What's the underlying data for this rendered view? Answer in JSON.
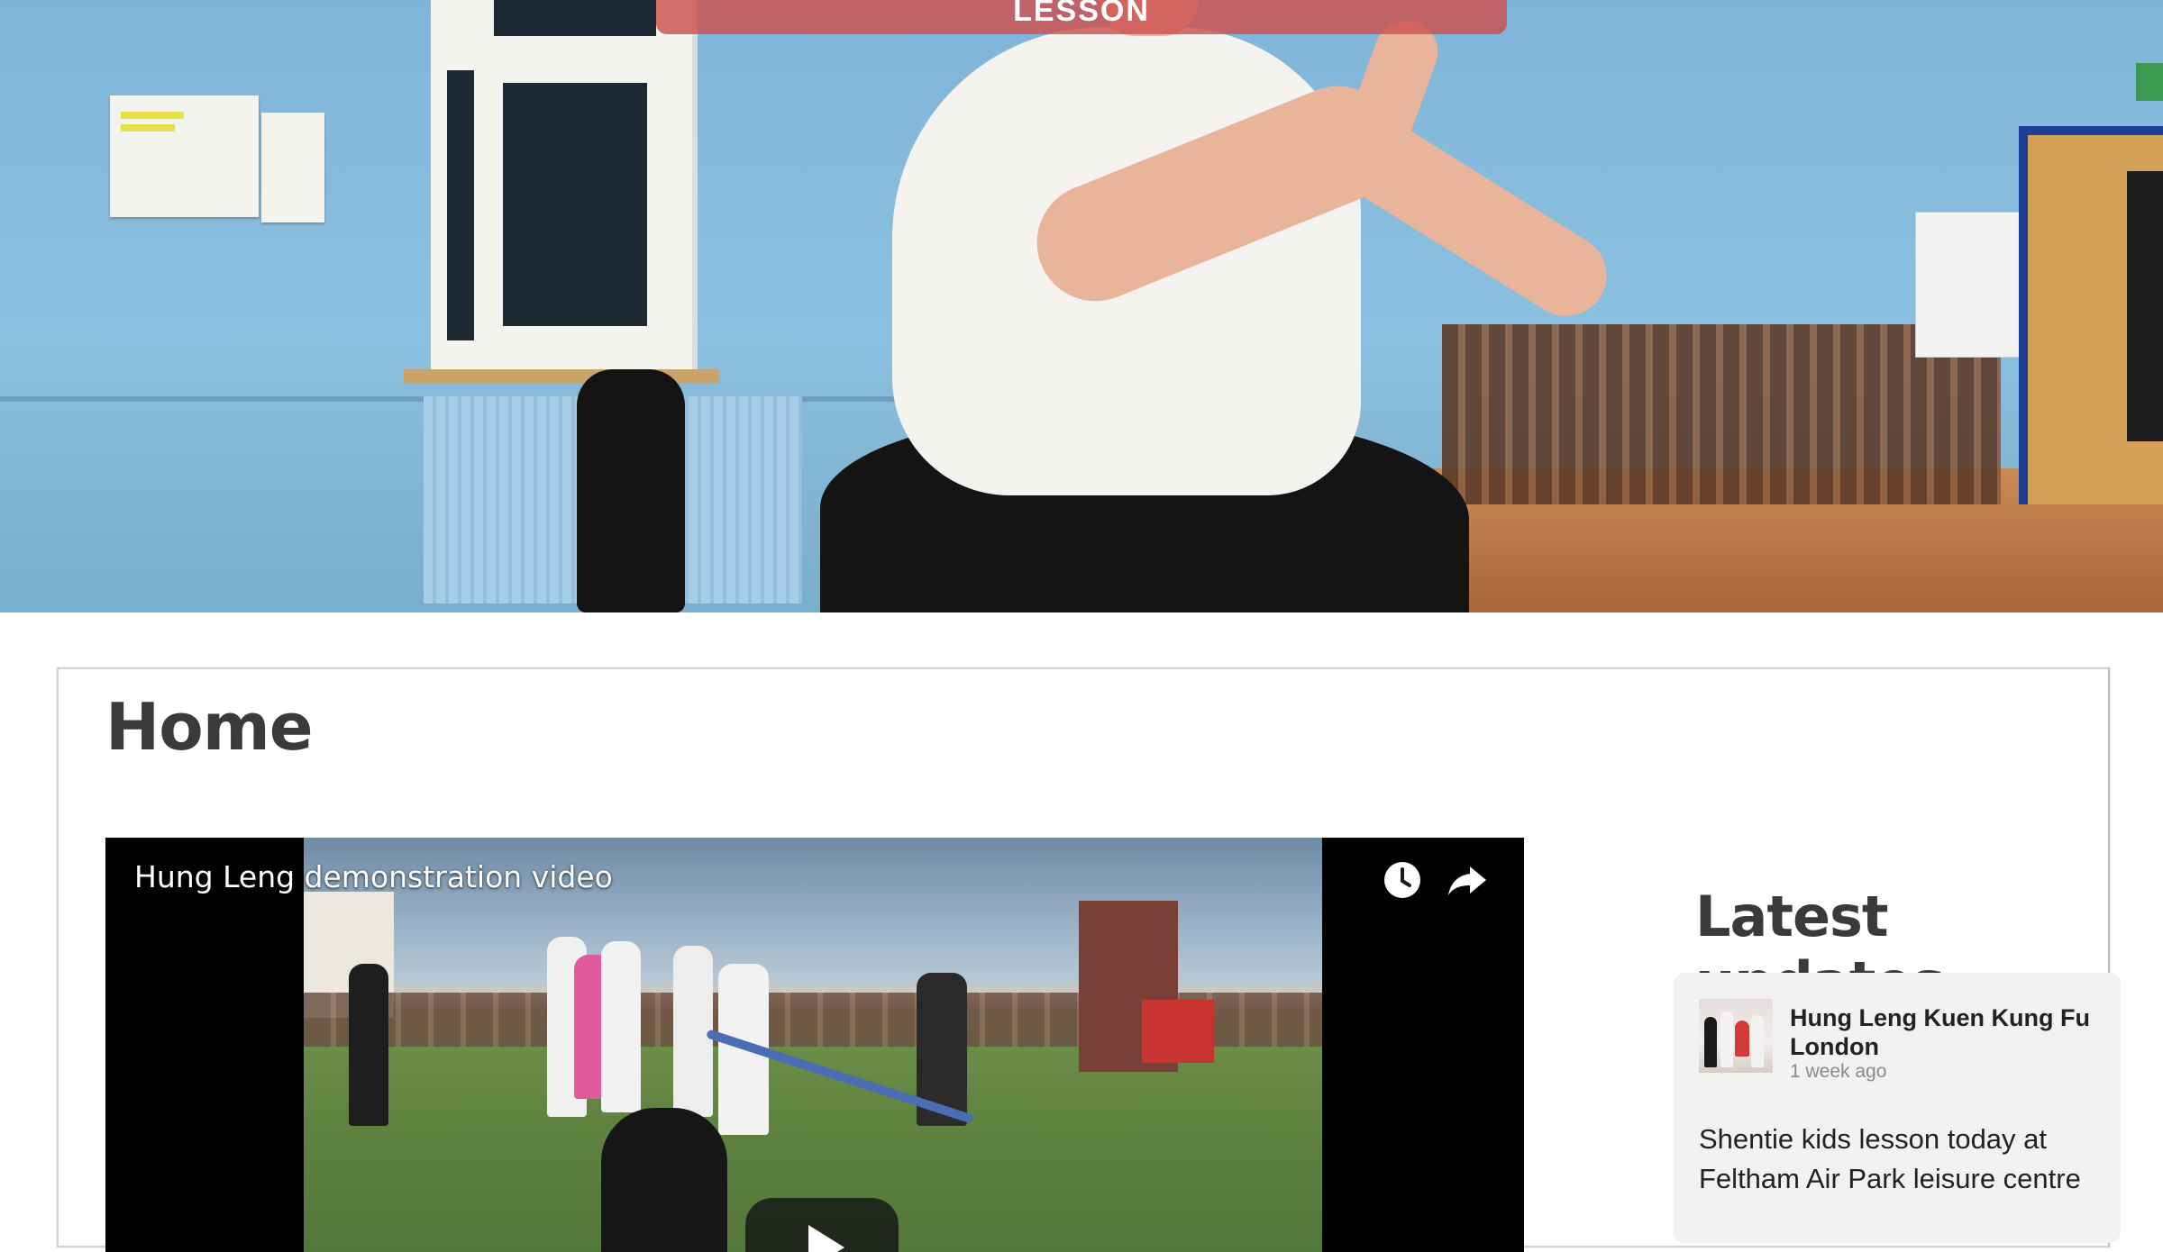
{
  "hero": {
    "cta_label": "Start training with your free taster lesson"
  },
  "page": {
    "title": "Home"
  },
  "video": {
    "title": "Hung Leng demonstration video",
    "watch_later_icon": "clock-icon",
    "share_icon": "share-arrow-icon",
    "play_icon": "play-icon"
  },
  "sidebar": {
    "heading": "Latest updates",
    "update": {
      "author": "Hung Leng Kuen Kung Fu London",
      "time": "1 week ago",
      "text": "Shentie kids lesson today at Feltham Air Park leisure centre"
    }
  },
  "colors": {
    "cta_background": "#cd5050",
    "heading_text": "#3a3a3a",
    "card_background": "#f2f2f2"
  }
}
